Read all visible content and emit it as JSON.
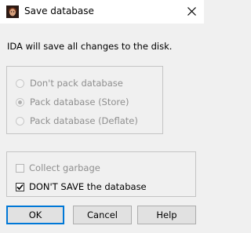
{
  "window": {
    "title": "Save database",
    "close_glyph": "×"
  },
  "message": "IDA will save all changes to the disk.",
  "pack_options": [
    {
      "label": "Don't pack database",
      "selected": false,
      "enabled": false
    },
    {
      "label": "Pack database (Store)",
      "selected": true,
      "enabled": false
    },
    {
      "label": "Pack database (Deflate)",
      "selected": false,
      "enabled": false
    }
  ],
  "checkboxes": [
    {
      "label": "Collect garbage",
      "checked": false,
      "enabled": false
    },
    {
      "label": "DON'T SAVE the database",
      "checked": true,
      "enabled": true
    }
  ],
  "buttons": {
    "ok": "OK",
    "cancel": "Cancel",
    "help": "Help"
  },
  "colors": {
    "default_button_border": "#0078d7",
    "disabled_text": "#8f8f8f"
  }
}
